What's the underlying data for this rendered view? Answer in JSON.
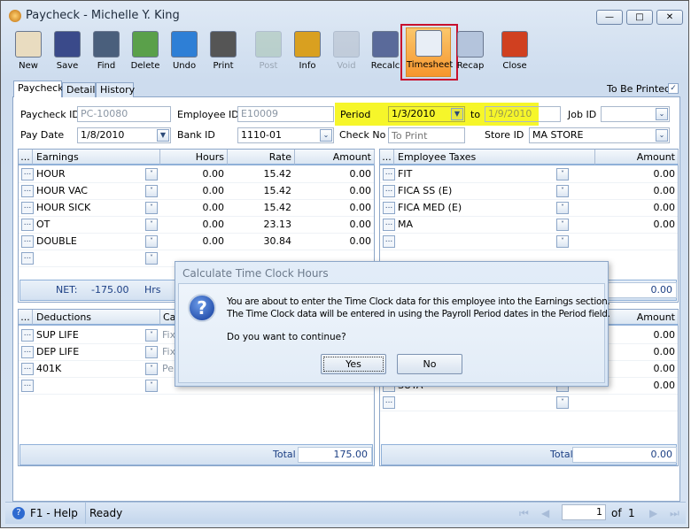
{
  "window": {
    "title": "Paycheck - Michelle Y. King",
    "controls": [
      "minimize",
      "restore",
      "close"
    ]
  },
  "toolbar": [
    {
      "label": "New",
      "icon": "new-form-icon",
      "color": "#e9dcc0",
      "enabled": true
    },
    {
      "label": "Save",
      "icon": "floppy-disk-icon",
      "color": "#3a4a8a",
      "enabled": true
    },
    {
      "label": "Find",
      "icon": "binoculars-icon",
      "color": "#4a5f7c",
      "enabled": true
    },
    {
      "label": "Delete",
      "icon": "recycle-bin-icon",
      "color": "#5aa04a",
      "enabled": true
    },
    {
      "label": "Undo",
      "icon": "undo-arrow-icon",
      "color": "#2e7fd6",
      "enabled": true
    },
    {
      "label": "Print",
      "icon": "printer-icon",
      "color": "#555",
      "enabled": true
    },
    {
      "label": "Post",
      "icon": "post-check-icon",
      "color": "#8ab08a",
      "enabled": false
    },
    {
      "label": "Info",
      "icon": "info-icon",
      "color": "#d9a020",
      "enabled": true
    },
    {
      "label": "Void",
      "icon": "void-icon",
      "color": "#a0a8b4",
      "enabled": false
    },
    {
      "label": "Recalc",
      "icon": "calculator-icon",
      "color": "#5a6a9a",
      "enabled": true
    },
    {
      "label": "Timesheet",
      "icon": "timesheet-clock-icon",
      "color": "#e8eef6",
      "enabled": true,
      "selected": true
    },
    {
      "label": "Recap",
      "icon": "recap-sheet-icon",
      "color": "#b4c4dc",
      "enabled": true
    },
    {
      "label": "Close",
      "icon": "close-form-icon",
      "color": "#d04020",
      "enabled": true
    }
  ],
  "tabs": [
    "Paycheck",
    "Detail",
    "History"
  ],
  "to_be_printed": {
    "label": "To Be Printed",
    "checked": true
  },
  "form": {
    "paycheck_id": {
      "label": "Paycheck ID",
      "value": "PC-10080"
    },
    "employee_id": {
      "label": "Employee ID",
      "value": "E10009"
    },
    "period": {
      "label": "Period",
      "from": "1/3/2010",
      "to_label": "to",
      "to": "1/9/2010"
    },
    "job_id": {
      "label": "Job ID",
      "value": ""
    },
    "pay_date": {
      "label": "Pay Date",
      "value": "1/8/2010"
    },
    "bank_id": {
      "label": "Bank ID",
      "value": "1110-01"
    },
    "check_no": {
      "label": "Check No",
      "placeholder": "To Print"
    },
    "store_id": {
      "label": "Store ID",
      "value": "MA STORE"
    }
  },
  "earnings": {
    "columns": [
      "Earnings",
      "Hours",
      "Rate",
      "Amount"
    ],
    "rows": [
      [
        "HOUR",
        "0.00",
        "15.42",
        "0.00"
      ],
      [
        "HOUR VAC",
        "0.00",
        "15.42",
        "0.00"
      ],
      [
        "HOUR SICK",
        "0.00",
        "15.42",
        "0.00"
      ],
      [
        "OT",
        "0.00",
        "23.13",
        "0.00"
      ],
      [
        "DOUBLE",
        "0.00",
        "30.84",
        "0.00"
      ],
      [
        "",
        "",
        "",
        ""
      ]
    ],
    "net_label": "NET:",
    "net_value": "-175.00",
    "hrs_label": "Hrs"
  },
  "employee_taxes": {
    "columns": [
      "Employee Taxes",
      "Amount"
    ],
    "rows": [
      [
        "FIT",
        "0.00"
      ],
      [
        "FICA SS (E)",
        "0.00"
      ],
      [
        "FICA MED (E)",
        "0.00"
      ],
      [
        "MA",
        "0.00"
      ],
      [
        "",
        ""
      ]
    ],
    "total": "0.00"
  },
  "deductions": {
    "columns": [
      "Deductions",
      "Ca"
    ],
    "rows": [
      [
        "SUP LIFE",
        "Fix"
      ],
      [
        "DEP LIFE",
        "Fix"
      ],
      [
        "401K",
        "Pe"
      ],
      [
        "",
        ""
      ]
    ],
    "total_label": "Total",
    "total": "175.00"
  },
  "employer_taxes": {
    "columns": [
      "Amount"
    ],
    "rows": [
      [
        "",
        "0.00"
      ],
      [
        "",
        "0.00"
      ],
      [
        "",
        "0.00"
      ],
      [
        "SUTA",
        "0.00"
      ],
      [
        "",
        ""
      ]
    ],
    "total_label": "Total",
    "total": "0.00"
  },
  "dialog": {
    "title": "Calculate Time Clock Hours",
    "line1": "You are about to enter the Time Clock data for this employee into the Earnings section.",
    "line2": "The Time Clock data will be entered in using the Payroll Period dates in the Period field.",
    "question": "Do you want to continue?",
    "yes": "Yes",
    "no": "No"
  },
  "status": {
    "help": "F1 - Help",
    "state": "Ready",
    "page": "1",
    "of_label": "of",
    "total_pages": "1"
  }
}
